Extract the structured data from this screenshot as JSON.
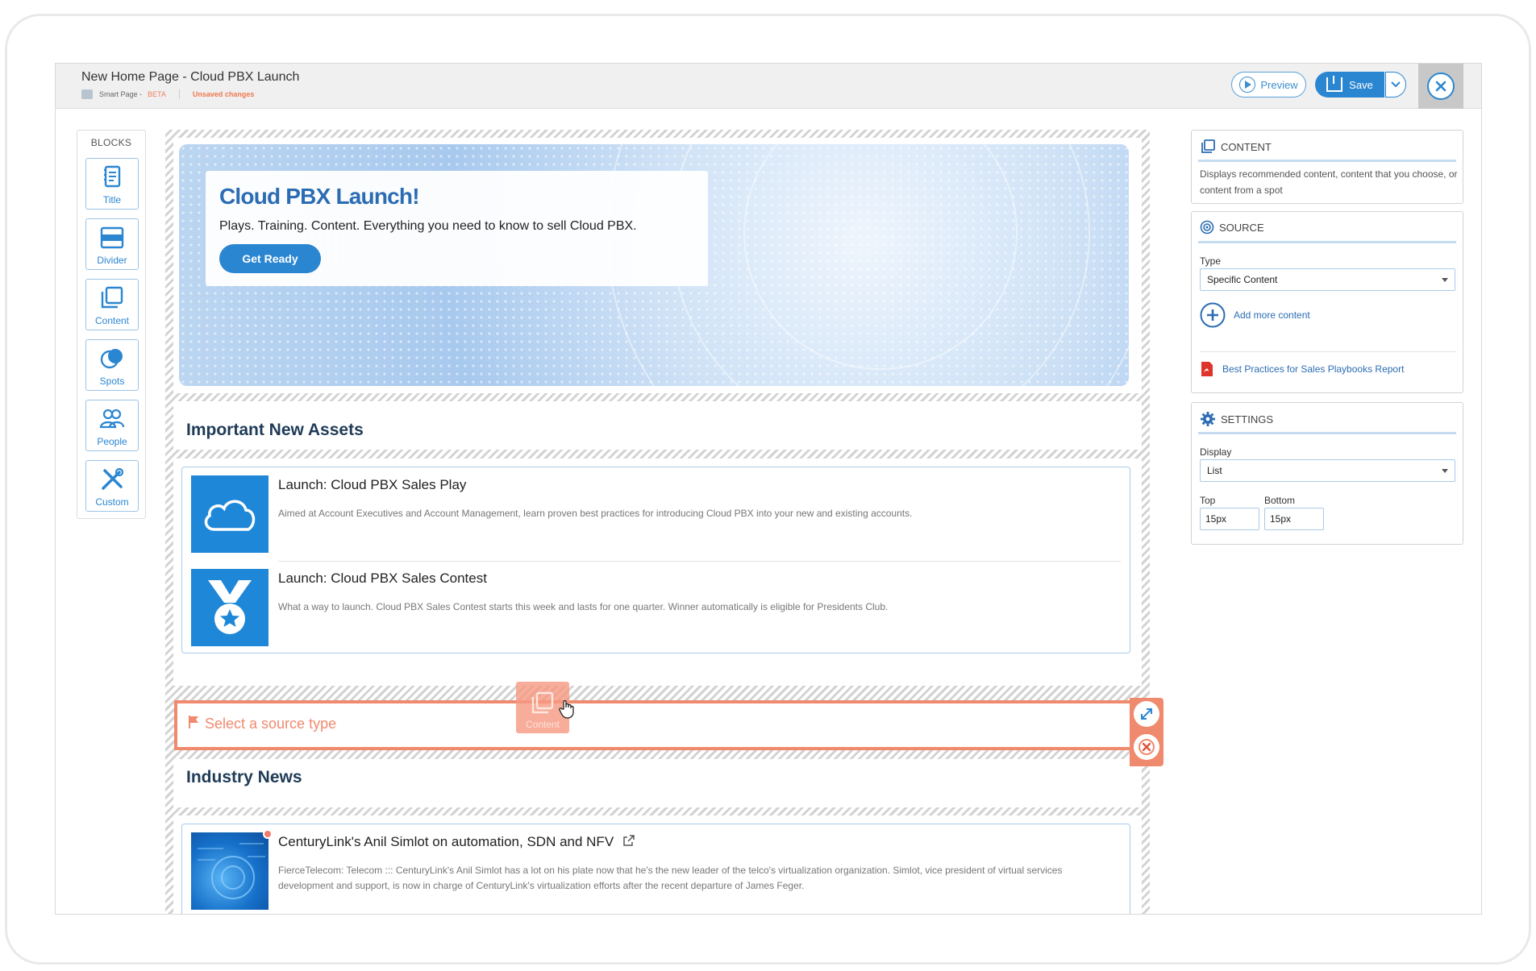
{
  "header": {
    "title": "New Home Page - Cloud PBX Launch",
    "page_type": "Smart Page - ",
    "beta": "BETA",
    "status": "Unsaved changes",
    "preview_label": "Preview",
    "save_label": "Save"
  },
  "blocks": {
    "title": "BLOCKS",
    "items": [
      {
        "label": "Title",
        "icon": "notebook-icon"
      },
      {
        "label": "Divider",
        "icon": "divider-icon"
      },
      {
        "label": "Content",
        "icon": "content-copy-icon"
      },
      {
        "label": "Spots",
        "icon": "spots-icon"
      },
      {
        "label": "People",
        "icon": "people-icon"
      },
      {
        "label": "Custom",
        "icon": "tools-icon"
      }
    ]
  },
  "hero": {
    "title": "Cloud PBX Launch!",
    "text": "Plays. Training. Content. Everything you need to know to sell Cloud PBX.",
    "button": "Get Ready"
  },
  "sections": {
    "assets_heading": "Important New Assets",
    "news_heading": "Industry News"
  },
  "assets": [
    {
      "title": "Launch: Cloud PBX Sales Play",
      "desc": "Aimed at Account Executives and Account Management, learn proven best practices for introducing Cloud PBX into your new and existing accounts.",
      "icon": "cloud-icon"
    },
    {
      "title": "Launch: Cloud PBX Sales Contest",
      "desc": "What a way to launch. Cloud PBX Sales Contest starts this week and lasts for one quarter. Winner automatically is eligible for Presidents Club.",
      "icon": "medal-icon"
    }
  ],
  "selected_block": {
    "placeholder": "Select a source type",
    "drag_label": "Content"
  },
  "news": [
    {
      "title": "CenturyLink's Anil Simlot on automation, SDN and NFV",
      "desc": "FierceTelecom: Telecom ::: CenturyLink's Anil Simlot has a lot on his plate now that he's the new leader of the telco's virtualization organization. Simlot, vice president of virtual services development and support, is now in charge of CenturyLink's virtualization efforts after the recent departure of James Feger."
    }
  ],
  "right_panel": {
    "content": {
      "heading": "CONTENT",
      "description": "Displays recommended content, content that you choose, or content from a spot"
    },
    "source": {
      "heading": "SOURCE",
      "type_label": "Type",
      "type_value": "Specific Content",
      "add_more": "Add more content",
      "file": "Best Practices for Sales Playbooks Report"
    },
    "settings": {
      "heading": "SETTINGS",
      "display_label": "Display",
      "display_value": "List",
      "top_label": "Top",
      "top_value": "15px",
      "bottom_label": "Bottom",
      "bottom_value": "15px"
    }
  },
  "colors": {
    "accent": "#2b86d1",
    "warning": "#f08a6e",
    "heading": "#1f3b57"
  }
}
